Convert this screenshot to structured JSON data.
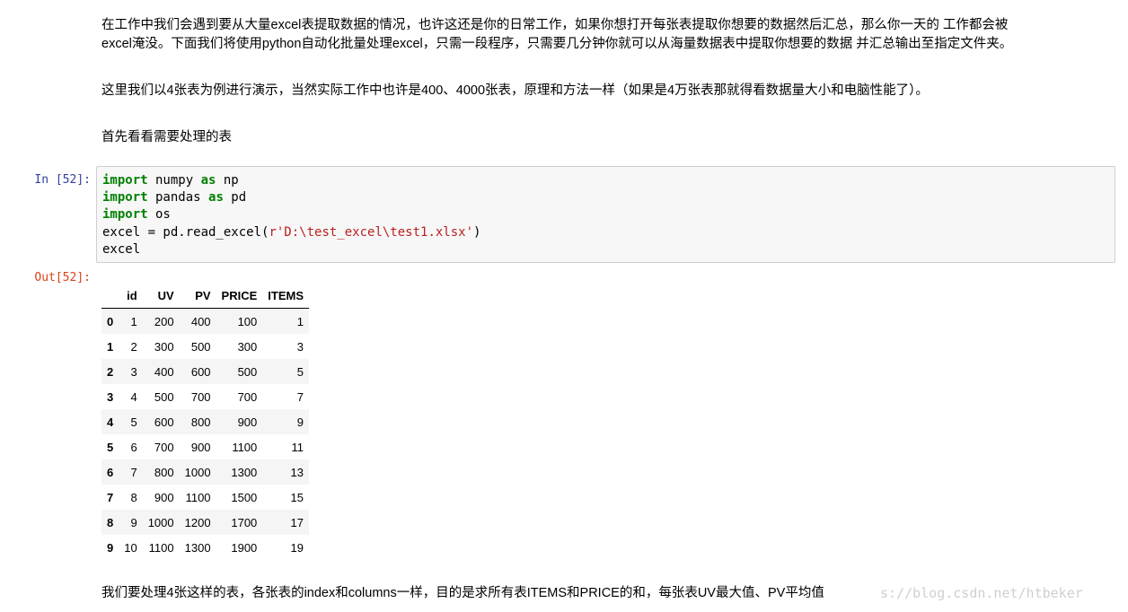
{
  "markdown": {
    "para1_line1": "在工作中我们会遇到要从大量excel表提取数据的情况，也许这还是你的日常工作，如果你想打开每张表提取你想要的数据然后汇总，那么你一天的 工作都会被",
    "para1_line2": "excel淹没。下面我们将使用python自动化批量处理excel，只需一段程序，只需要几分钟你就可以从海量数据表中提取你想要的数据 并汇总输出至指定文件夹。",
    "para2": "这里我们以4张表为例进行演示，当然实际工作中也许是400、4000张表，原理和方法一样（如果是4万张表那就得看数据量大小和电脑性能了）。",
    "para3": "首先看看需要处理的表",
    "para4": "我们要处理4张这样的表，各张表的index和columns一样，目的是求所有表ITEMS和PRICE的和，每张表UV最大值、PV平均值"
  },
  "cell": {
    "in_prompt": "In [52]:",
    "out_prompt": "Out[52]:",
    "code": {
      "l1": {
        "kw1": "import",
        "t1": " numpy ",
        "kw2": "as",
        "t2": " np"
      },
      "l2": {
        "kw1": "import",
        "t1": " pandas ",
        "kw2": "as",
        "t2": " pd"
      },
      "l3": {
        "kw1": "import",
        "t1": " os"
      },
      "l4": {
        "t1": "excel = pd.read_excel(",
        "s1": "r'D:\\test_excel\\test1.xlsx'",
        "t2": ")"
      },
      "l5": {
        "t1": "excel"
      }
    }
  },
  "dataframe": {
    "index_header": "",
    "columns": [
      "id",
      "UV",
      "PV",
      "PRICE",
      "ITEMS"
    ],
    "rows": [
      {
        "index": "0",
        "values": [
          "1",
          "200",
          "400",
          "100",
          "1"
        ]
      },
      {
        "index": "1",
        "values": [
          "2",
          "300",
          "500",
          "300",
          "3"
        ]
      },
      {
        "index": "2",
        "values": [
          "3",
          "400",
          "600",
          "500",
          "5"
        ]
      },
      {
        "index": "3",
        "values": [
          "4",
          "500",
          "700",
          "700",
          "7"
        ]
      },
      {
        "index": "4",
        "values": [
          "5",
          "600",
          "800",
          "900",
          "9"
        ]
      },
      {
        "index": "5",
        "values": [
          "6",
          "700",
          "900",
          "1100",
          "11"
        ]
      },
      {
        "index": "6",
        "values": [
          "7",
          "800",
          "1000",
          "1300",
          "13"
        ]
      },
      {
        "index": "7",
        "values": [
          "8",
          "900",
          "1100",
          "1500",
          "15"
        ]
      },
      {
        "index": "8",
        "values": [
          "9",
          "1000",
          "1200",
          "1700",
          "17"
        ]
      },
      {
        "index": "9",
        "values": [
          "10",
          "1100",
          "1300",
          "1900",
          "19"
        ]
      }
    ]
  },
  "watermark": "s://blog.csdn.net/htbeker"
}
